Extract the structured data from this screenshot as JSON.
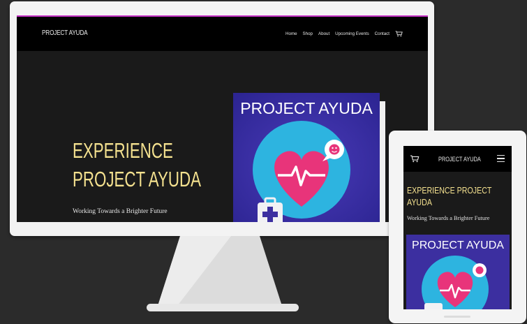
{
  "desktop": {
    "brand": "PROJECT AYUDA",
    "nav": [
      "Home",
      "Shop",
      "About",
      "Upcoming Events",
      "Contact"
    ],
    "hero_title_line1": "EXPERIENCE",
    "hero_title_line2": "PROJECT AYUDA",
    "hero_subtitle": "Working Towards a Brighter Future",
    "art_title": "PROJECT AYUDA"
  },
  "tablet": {
    "brand": "PROJECT AYUDA",
    "hero_title_line1": "EXPERIENCE PROJECT",
    "hero_title_line2": "AYUDA",
    "hero_subtitle": "Working Towards a Brighter Future",
    "art_title": "PROJECT AYUDA"
  },
  "icons": {
    "cart": "shopping-cart-icon",
    "menu": "hamburger-menu-icon",
    "heart": "heartbeat-heart-icon",
    "medkit": "first-aid-kit-icon",
    "speech": "speech-bubble-icon"
  },
  "colors": {
    "accent": "#c733c7",
    "title": "#f4e18f",
    "art_bg": "#3c2fa0",
    "art_circle": "#2db4e0",
    "heart": "#e8347a"
  }
}
